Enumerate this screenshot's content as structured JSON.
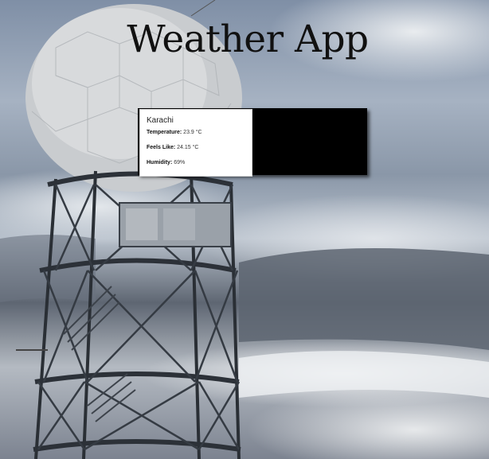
{
  "app": {
    "title": "Weather App"
  },
  "weather": {
    "city": "Karachi",
    "temperature": {
      "label": "Temperature:",
      "value": "23.9 °C"
    },
    "feels_like": {
      "label": "Feels Like:",
      "value": "24.15 °C"
    },
    "humidity": {
      "label": "Humidity:",
      "value": "69%"
    }
  },
  "colors": {
    "title_text": "#111111",
    "card_background": "#ffffff",
    "card_shadow": "#000000",
    "sky": "#8e98a6"
  },
  "background": {
    "subject": "weather-radar-tower-photo"
  }
}
